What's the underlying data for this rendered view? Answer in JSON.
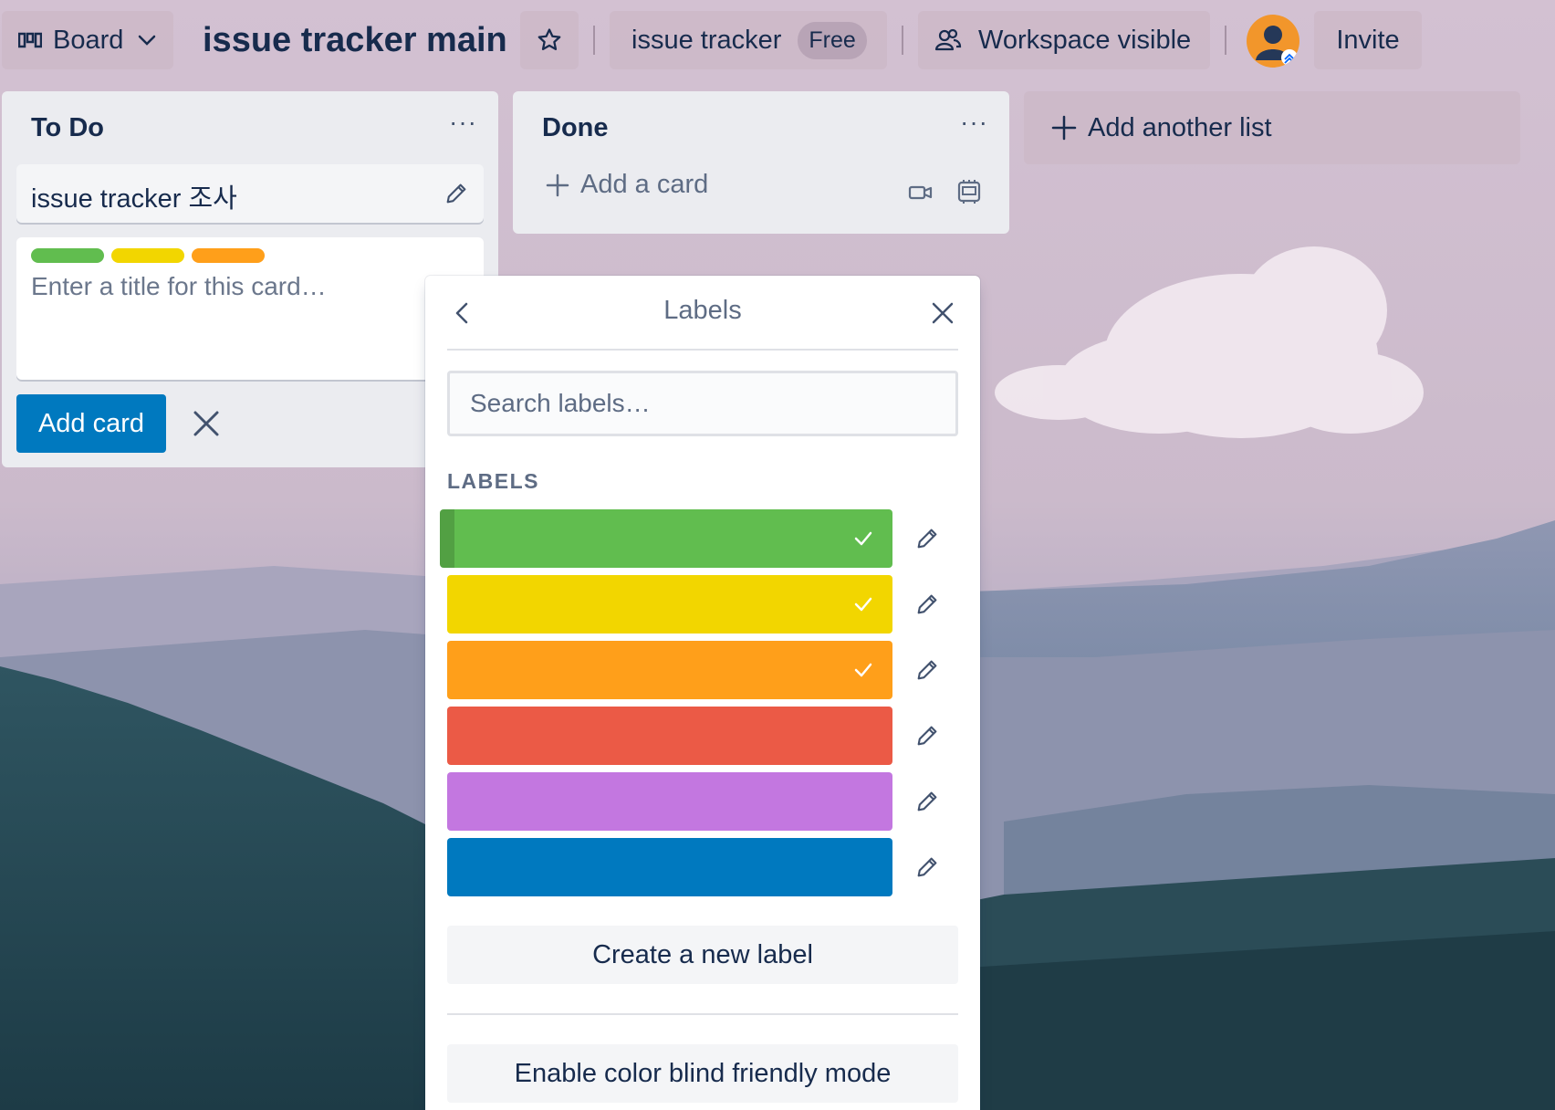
{
  "header": {
    "view_switcher_label": "Board",
    "board_title": "issue tracker main",
    "workspace_name": "issue tracker",
    "workspace_plan": "Free",
    "visibility_label": "Workspace visible",
    "invite_label": "Invite"
  },
  "lists": [
    {
      "title": "To Do",
      "cards": [
        {
          "title": "issue tracker 조사"
        }
      ],
      "composer": {
        "label_colors": [
          "#61bd4f",
          "#f2d600",
          "#ff9f1a"
        ],
        "placeholder": "Enter a title for this card…",
        "submit_label": "Add card"
      }
    },
    {
      "title": "Done",
      "add_card_label": "Add a card"
    }
  ],
  "add_list_label": "Add another list",
  "labels_popover": {
    "title": "Labels",
    "search_placeholder": "Search labels…",
    "section_heading": "LABELS",
    "labels": [
      {
        "color": "#61bd4f",
        "selected": true
      },
      {
        "color": "#f2d600",
        "selected": true
      },
      {
        "color": "#ff9f1a",
        "selected": true
      },
      {
        "color": "#eb5a46",
        "selected": false
      },
      {
        "color": "#c377e0",
        "selected": false
      },
      {
        "color": "#0079bf",
        "selected": false
      }
    ],
    "create_label": "Create a new label",
    "color_blind_label": "Enable color blind friendly mode"
  }
}
